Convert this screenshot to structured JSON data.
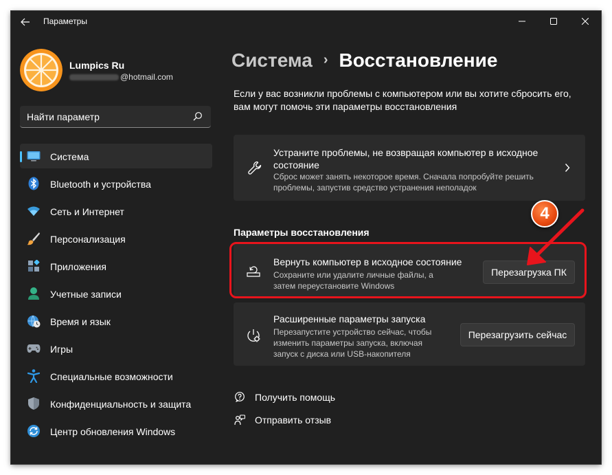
{
  "window": {
    "title": "Параметры"
  },
  "user": {
    "name": "Lumpics Ru",
    "email_domain": "@hotmail.com"
  },
  "search": {
    "placeholder": "Найти параметр"
  },
  "sidebar": {
    "items": [
      {
        "label": "Система",
        "icon": "monitor-icon",
        "active": true
      },
      {
        "label": "Bluetooth и устройства",
        "icon": "bluetooth-icon"
      },
      {
        "label": "Сеть и Интернет",
        "icon": "wifi-icon"
      },
      {
        "label": "Персонализация",
        "icon": "brush-icon"
      },
      {
        "label": "Приложения",
        "icon": "apps-icon"
      },
      {
        "label": "Учетные записи",
        "icon": "person-icon"
      },
      {
        "label": "Время и язык",
        "icon": "globe-clock-icon"
      },
      {
        "label": "Игры",
        "icon": "gamepad-icon"
      },
      {
        "label": "Специальные возможности",
        "icon": "accessibility-icon"
      },
      {
        "label": "Конфиденциальность и защита",
        "icon": "shield-icon"
      },
      {
        "label": "Центр обновления Windows",
        "icon": "update-icon"
      }
    ]
  },
  "breadcrumb": {
    "parent": "Система",
    "separator": "›",
    "current": "Восстановление"
  },
  "description": "Если у вас возникли проблемы с компьютером или вы хотите сбросить его, вам могут помочь эти параметры восстановления",
  "fix_card": {
    "title": "Устраните проблемы, не возвращая компьютер в исходное состояние",
    "subtitle": "Сброс может занять некоторое время. Сначала попробуйте решить проблемы, запустив средство устранения неполадок"
  },
  "recovery_section": {
    "title": "Параметры восстановления"
  },
  "reset_card": {
    "title": "Вернуть компьютер в исходное состояние",
    "subtitle": "Сохраните или удалите личные файлы, а затем переустановите Windows",
    "button": "Перезагрузка ПК"
  },
  "advanced_card": {
    "title": "Расширенные параметры запуска",
    "subtitle": "Перезапустите устройство сейчас, чтобы изменить параметры запуска, включая запуск с диска или USB-накопителя",
    "button": "Перезагрузить сейчас"
  },
  "links": {
    "help": "Получить помощь",
    "feedback": "Отправить отзыв"
  },
  "annotation": {
    "step": "4"
  },
  "colors": {
    "accent": "#4cc2ff",
    "highlight": "#e8141c",
    "badge": "#e84a10",
    "background": "#202020",
    "card": "#2b2b2b"
  }
}
